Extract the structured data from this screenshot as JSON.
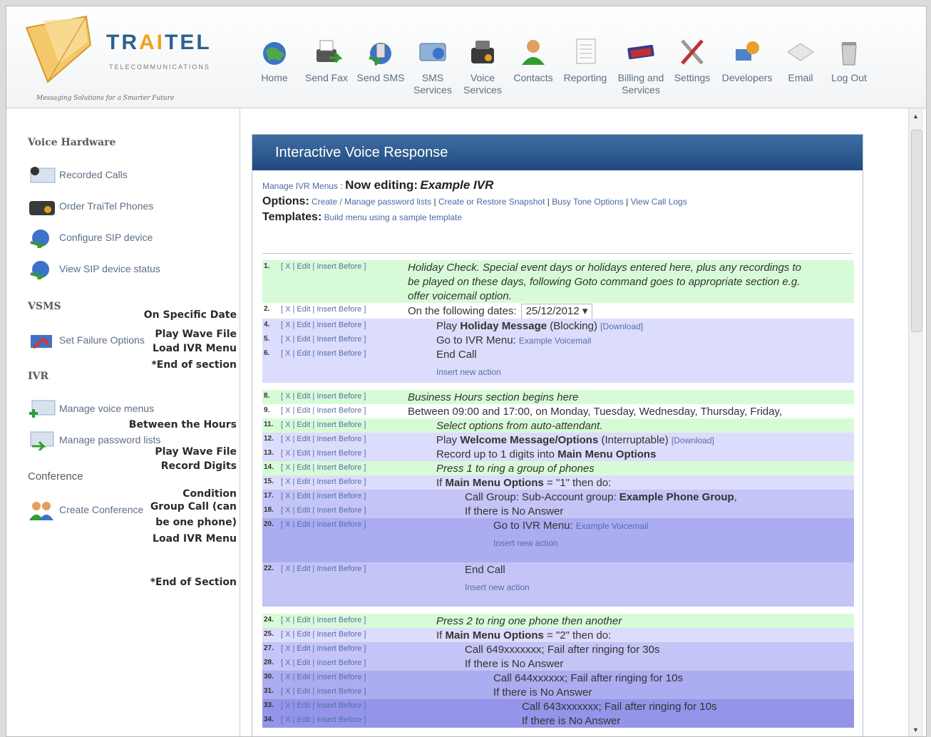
{
  "brand": {
    "name": "TRAITEL",
    "sub": "TELECOMMUNICATIONS",
    "tagline": "Messaging Solutions for a Smarter Future"
  },
  "nav": [
    {
      "label": "Home",
      "icon": "globe-icon"
    },
    {
      "label": "Send Fax",
      "icon": "fax-icon"
    },
    {
      "label": "Send SMS",
      "icon": "sms-icon"
    },
    {
      "label": "SMS\nServices",
      "icon": "sms-services-icon"
    },
    {
      "label": "Voice\nServices",
      "icon": "voice-services-icon"
    },
    {
      "label": "Contacts",
      "icon": "contacts-icon"
    },
    {
      "label": "Reporting",
      "icon": "reporting-icon"
    },
    {
      "label": "Billing and\nServices",
      "icon": "billing-icon"
    },
    {
      "label": "Settings",
      "icon": "settings-icon"
    },
    {
      "label": "Developers",
      "icon": "developers-icon"
    },
    {
      "label": "Email",
      "icon": "email-icon"
    },
    {
      "label": "Log Out",
      "icon": "trash-icon"
    }
  ],
  "sidebar": {
    "voice_hardware": "Voice Hardware",
    "vsms": "VSMS",
    "ivr": "IVR",
    "conference": "Conference",
    "items": [
      {
        "label": "Recorded Calls"
      },
      {
        "label": "Order TraiTel Phones"
      },
      {
        "label": "Configure SIP device"
      },
      {
        "label": "View SIP device status"
      },
      {
        "label": "Set Failure Options"
      },
      {
        "label": "Manage voice menus"
      },
      {
        "label": "Manage password lists"
      },
      {
        "label": "Create Conference"
      }
    ],
    "side_labels": [
      "On Specific Date",
      "Play Wave File",
      "Load IVR Menu",
      "*End of section",
      "Between the Hours",
      "Play Wave File",
      "Record Digits",
      "Condition",
      "Group Call (can",
      "be one phone)",
      "Load IVR Menu",
      "*End of Section"
    ]
  },
  "panel": {
    "title": "Interactive Voice Response",
    "manage_link": "Manage IVR Menus",
    "now_editing_label": "Now editing:",
    "now_editing_name": "Example IVR",
    "options_label": "Options:",
    "options": [
      "Create / Manage password lists",
      "Create or Restore Snapshot",
      "Busy Tone Options",
      "View Call Logs"
    ],
    "templates_label": "Templates:",
    "templates_link": "Build menu using a sample template"
  },
  "actions_label": "[ X | Edit | Insert Before ]",
  "insert_new_action": "Insert new action",
  "rows": [
    {
      "num": "1.",
      "pre": "",
      "bold": "",
      "post": "Holiday Check. Special event days or holidays entered here, plus any recordings to",
      "line2": "be played on these days, following Goto command goes to appropriate section e.g.",
      "line3": "offer voicemail option.",
      "italic": true,
      "color": "#d7fbd7"
    },
    {
      "num": "2.",
      "pre": "On the following dates:",
      "date": "25/12/2012",
      "color": "#ffffff"
    },
    {
      "num": "4.",
      "pre": "Play ",
      "bold": "Holiday Message",
      "post": " (Blocking) ",
      "link": "[Download]",
      "color": "#dcdcfc"
    },
    {
      "num": "5.",
      "pre": "Go to IVR Menu: ",
      "link": "Example Voicemail",
      "color": "#dcdcfc"
    },
    {
      "num": "6.",
      "pre": "End Call",
      "color": "#dcdcfc"
    },
    {
      "num": "8.",
      "pre": "Business Hours section begins here",
      "italic": true,
      "color": "#d7fbd7"
    },
    {
      "num": "9.",
      "pre": "Between 09:00 and 17:00, on Monday, Tuesday, Wednesday, Thursday, Friday,",
      "color": "#ffffff"
    },
    {
      "num": "11.",
      "pre": "Select options from auto-attendant.",
      "italic": true,
      "color": "#d7fbd7"
    },
    {
      "num": "12.",
      "pre": "Play ",
      "bold": "Welcome Message/Options",
      "post": " (Interruptable) ",
      "link": "[Download]",
      "color": "#dcdcfc"
    },
    {
      "num": "13.",
      "pre": "Record up to 1 digits into ",
      "bold": "Main Menu Options",
      "color": "#dcdcfc"
    },
    {
      "num": "14.",
      "pre": "Press 1 to ring a group of phones",
      "italic": true,
      "color": "#d7fbd7"
    },
    {
      "num": "15.",
      "pre": "If ",
      "bold": "Main Menu Options",
      "post": " = \"1\" then do:",
      "color": "#dcdcfc"
    },
    {
      "num": "17.",
      "pre": "Call Group: Sub-Account group: ",
      "bold": "Example Phone Group",
      "post": ",",
      "color": "#c4c4f6"
    },
    {
      "num": "18.",
      "pre": "If there is No Answer",
      "color": "#c4c4f6"
    },
    {
      "num": "20.",
      "pre": "Go to IVR Menu: ",
      "link": "Example Voicemail",
      "color": "#acacf0"
    },
    {
      "num": "22.",
      "pre": "End Call",
      "color": "#c4c4f6"
    },
    {
      "num": "24.",
      "pre": "Press 2 to ring one phone then another",
      "italic": true,
      "color": "#d7fbd7"
    },
    {
      "num": "25.",
      "pre": "If ",
      "bold": "Main Menu Options",
      "post": " = \"2\" then do:",
      "color": "#dcdcfc"
    },
    {
      "num": "27.",
      "pre": "Call 649xxxxxxx; Fail after ringing for 30s",
      "color": "#c4c4f6"
    },
    {
      "num": "28.",
      "pre": "If there is No Answer",
      "color": "#c4c4f6"
    },
    {
      "num": "30.",
      "pre": "Call 644xxxxxx; Fail after ringing for 10s",
      "color": "#acacf0"
    },
    {
      "num": "31.",
      "pre": "If there is No Answer",
      "color": "#acacf0"
    },
    {
      "num": "33.",
      "pre": "Call 643xxxxxxx; Fail after ringing for 10s",
      "color": "#9494ea"
    },
    {
      "num": "34.",
      "pre": "If there is No Answer",
      "color": "#9494ea"
    }
  ]
}
